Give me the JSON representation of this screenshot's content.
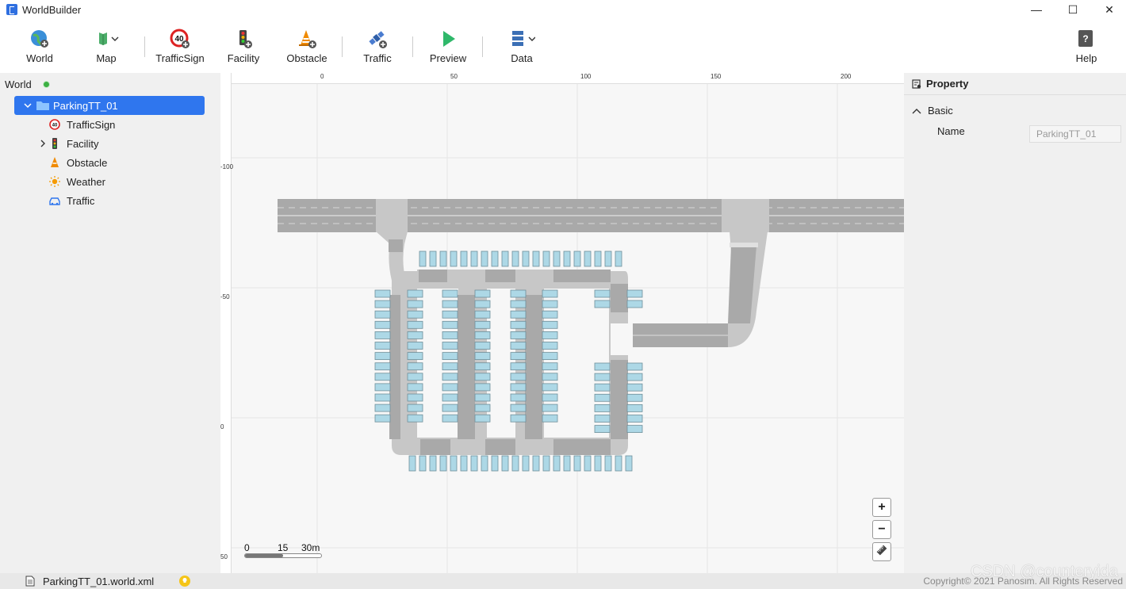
{
  "window": {
    "title": "WorldBuilder",
    "minimize": "—",
    "maximize": "☐",
    "close": "✕"
  },
  "toolbar": {
    "world": "World",
    "map": "Map",
    "traffic_sign": "TrafficSign",
    "traffic_sign_icon_text": "40",
    "facility": "Facility",
    "obstacle": "Obstacle",
    "traffic": "Traffic",
    "preview": "Preview",
    "data": "Data",
    "help": "Help"
  },
  "tree": {
    "root": "World",
    "world_item": "ParkingTT_01",
    "children": [
      {
        "label": "TrafficSign",
        "icon": "traffic-sign-icon"
      },
      {
        "label": "Facility",
        "icon": "traffic-light-icon"
      },
      {
        "label": "Obstacle",
        "icon": "cone-icon"
      },
      {
        "label": "Weather",
        "icon": "sun-icon"
      },
      {
        "label": "Traffic",
        "icon": "car-icon"
      }
    ]
  },
  "map": {
    "ruler_x": [
      "0",
      "50",
      "100",
      "150",
      "200"
    ],
    "ruler_y": [
      "-100",
      "-50",
      "0",
      "50"
    ],
    "scale": {
      "t0": "0",
      "t1": "15",
      "t2": "30m"
    },
    "zoom_in": "+",
    "zoom_out": "−"
  },
  "property": {
    "title": "Property",
    "section": "Basic",
    "name_label": "Name",
    "name_value": "ParkingTT_01"
  },
  "status": {
    "file": "ParkingTT_01.world.xml",
    "copyright": "Copyright© 2021 Panosim. All Rights Reserved"
  },
  "watermark": "CSDN @counteryida",
  "colors": {
    "accent": "#2f76ee",
    "road": "#a9a9a9",
    "parking_slot": "#add8e6",
    "preview_green": "#2fb86a"
  }
}
